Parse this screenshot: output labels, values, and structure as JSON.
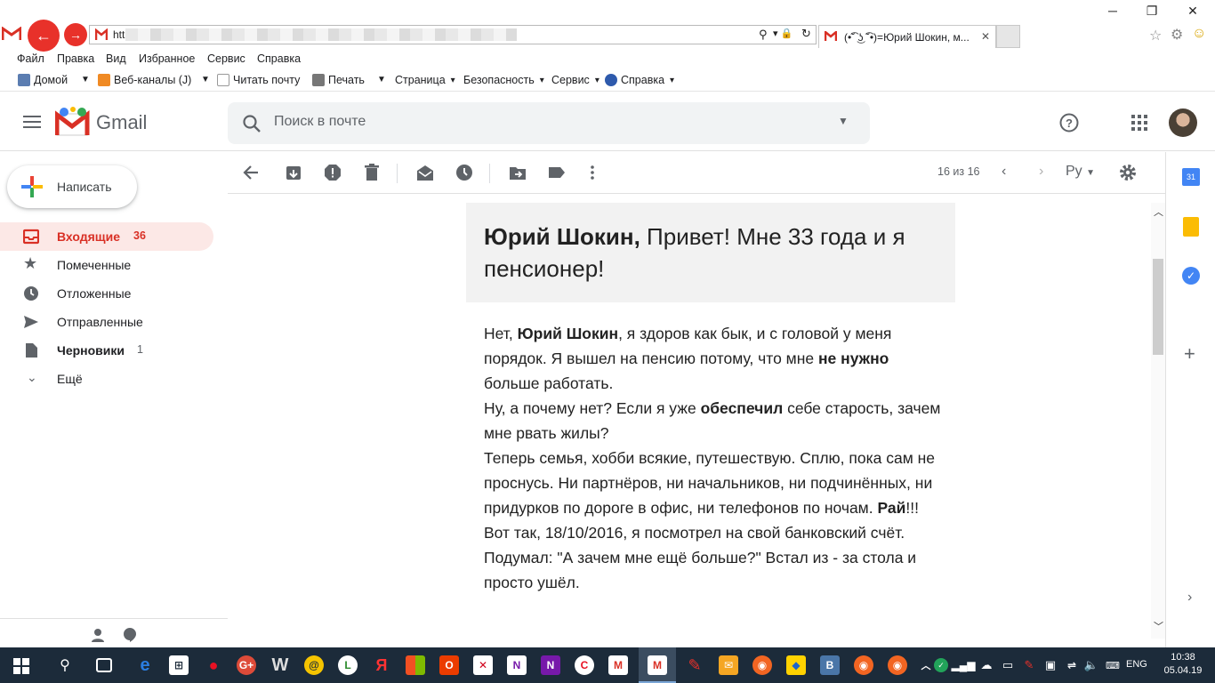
{
  "browser": {
    "address_text": "htt",
    "tab_title": "(•͡˘ ͜ʖ ͡˘•)=Юрий Шокин, м...",
    "window_buttons": [
      "─",
      "❐",
      "✕"
    ]
  },
  "menubar": {
    "items": [
      "Файл",
      "Правка",
      "Вид",
      "Избранное",
      "Сервис",
      "Справка"
    ]
  },
  "favbar": {
    "home": "Домой",
    "feeds": "Веб-каналы (J)",
    "read_mail": "Читать почту",
    "print": "Печать",
    "page": "Страница",
    "safety": "Безопасность",
    "tools": "Сервис",
    "help": "Справка"
  },
  "gmail": {
    "logo_text": "Gmail",
    "search_placeholder": "Поиск в почте",
    "compose_label": "Написать",
    "sidebar": [
      {
        "label": "Входящие",
        "count": "36",
        "icon": "inbox-icon"
      },
      {
        "label": "Помеченные",
        "count": "",
        "icon": "star-icon"
      },
      {
        "label": "Отложенные",
        "count": "",
        "icon": "clock-icon"
      },
      {
        "label": "Отправленные",
        "count": "",
        "icon": "send-icon"
      },
      {
        "label": "Черновики",
        "count": "1",
        "icon": "draft-icon"
      },
      {
        "label": "Ещё",
        "count": "",
        "icon": "chevron-down-icon"
      }
    ],
    "pager": "16 из 16",
    "language": "Ру"
  },
  "message": {
    "header_name": "Юрий Шокин,",
    "header_text": " Привет! Мне 33 года и я пенсионер!",
    "p1_a": "Нет, ",
    "p1_b": "Юрий Шокин",
    "p1_c": ", я здоров как бык, и с головой у меня порядок. Я вышел на пенсию потому, что мне ",
    "p1_d": "не нужно",
    "p1_e": " больше работать.",
    "p2_a": "Ну, а почему нет? Если я уже ",
    "p2_b": "обеспечил",
    "p2_c": " себе старость, зачем мне рвать жилы?",
    "p3_a": "Теперь семья, хобби всякие, путешествую. Сплю, пока сам не проснусь. Ни партнёров, ни начальников, ни подчинённых, ни придурков по дороге в офис, ни телефонов по ночам. ",
    "p3_b": "Рай",
    "p3_c": "!!!",
    "p4": "Вот так, 18/10/2016, я посмотрел на свой банковский счёт.",
    "p5": "Подумал: \"А зачем мне ещё больше?\" Встал из - за стола и просто ушёл."
  },
  "taskbar": {
    "language": "ENG",
    "time": "10:38",
    "date": "05.04.19"
  },
  "colors": {
    "gmail_red": "#d93025",
    "taskbar": "#1c2b3a",
    "highlight": "#fce8e6"
  }
}
